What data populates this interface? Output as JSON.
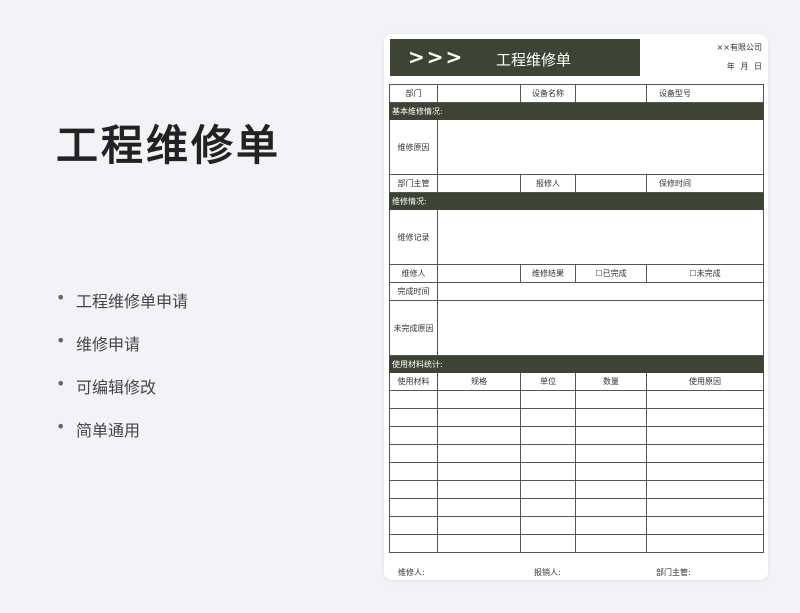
{
  "left": {
    "title": "工程维修单",
    "bullets": [
      "工程维修单申请",
      "维修申请",
      "可编辑修改",
      "简单通用"
    ]
  },
  "doc": {
    "banner_arrows": ">>>",
    "banner_title": "工程维修单",
    "company": "××有限公司",
    "date": "年 月 日",
    "row1": {
      "dept": "部门",
      "device_name": "设备名称",
      "device_model": "设备型号"
    },
    "sec_basic": "基本维修情况:",
    "repair_reason": "维修原因",
    "row_mgr": {
      "dept_mgr": "部门主管",
      "reporter": "报修人",
      "warranty_time": "保修时间"
    },
    "sec_repair": "维修情况:",
    "repair_record": "维修记录",
    "row_repairer": {
      "repairer": "维修人",
      "result": "维修结果",
      "done": "☐已完成",
      "not_done": "☐未完成"
    },
    "finish_time": "完成时间",
    "unfinished_reason": "未完成原因",
    "sec_material": "使用材料统计:",
    "material_headers": [
      "使用材料",
      "规格",
      "单位",
      "数量",
      "使用原因"
    ],
    "footer": {
      "repairer": "维修人:",
      "seller": "报销人:",
      "dept_mgr": "部门主管:"
    }
  },
  "colors": {
    "accent": "#3e4434",
    "background": "#f2f3f6"
  }
}
